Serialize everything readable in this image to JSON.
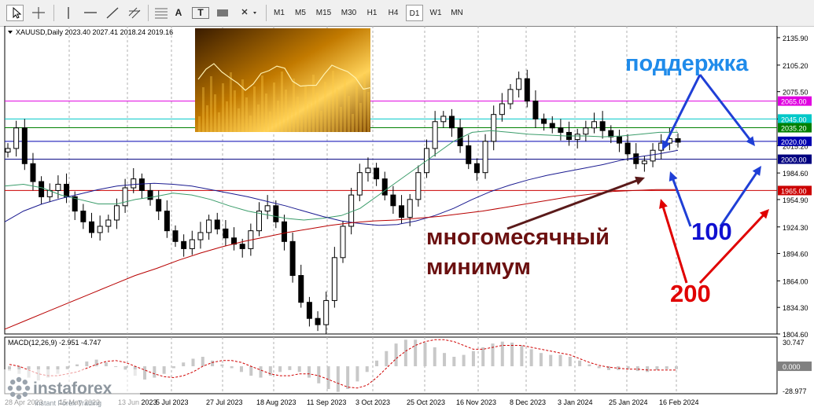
{
  "toolbar": {
    "tools": [
      "cursor-icon",
      "crosshair-icon",
      "vertical-line-icon",
      "horizontal-line-icon",
      "trendline-icon",
      "channel-icon",
      "text-icon",
      "label-icon",
      "shape-icon",
      "arrow-icon"
    ],
    "text_tool": "A",
    "label_tool": "T",
    "timeframes": [
      "M1",
      "M5",
      "M15",
      "M30",
      "H1",
      "H4",
      "D1",
      "W1",
      "MN"
    ],
    "active_timeframe": "D1"
  },
  "chart_data": {
    "type": "candlestick",
    "symbol": "XAUUSD,Daily",
    "ohlc": "2023.40 2027.41 2018.24 2019.16",
    "y_ticks": [
      "2135.90",
      "2105.20",
      "2075.50",
      "2045.00",
      "2015.20",
      "1984.60",
      "1954.90",
      "1924.30",
      "1894.60",
      "1864.00",
      "1834.30",
      "1804.60"
    ],
    "ylim": [
      1804.6,
      2149
    ],
    "x_labels": [
      "28 Apr 2023",
      "15 May 2023",
      "13 Jun 2023",
      "5 Jul 2023",
      "27 Jul 2023",
      "18 Aug 2023",
      "11 Sep 2023",
      "3 Oct 2023",
      "25 Oct 2023",
      "16 Nov 2023",
      "8 Dec 2023",
      "3 Jan 2024",
      "25 Jan 2024",
      "16 Feb 2024"
    ],
    "price_levels": [
      {
        "value": 2065.0,
        "label": "2065.00",
        "color": "#e000e0"
      },
      {
        "value": 2045.0,
        "label": "2045.00",
        "color": "#00c8c8"
      },
      {
        "value": 2035.2,
        "label": "2035.20",
        "color": "#008000"
      },
      {
        "value": 2020.0,
        "label": "2020.00",
        "color": "#0000b0"
      },
      {
        "value": 2000.0,
        "label": "2000.00",
        "color": "#000080"
      },
      {
        "value": 1965.0,
        "label": "1965.00",
        "color": "#cc0000"
      }
    ],
    "series": [
      {
        "name": "",
        "close": [
          2012,
          2035,
          1995,
          1975,
          1958,
          1965,
          1972,
          1958,
          1942,
          1930,
          1918,
          1925,
          1932,
          1948,
          1968,
          1978,
          1965,
          1955,
          1942,
          1920,
          1908,
          1900,
          1910,
          1918,
          1932,
          1922,
          1912,
          1905,
          1900,
          1920,
          1942,
          1948,
          1930,
          1908,
          1870,
          1840,
          1822,
          1815,
          1842,
          1890,
          1925,
          1960,
          1985,
          1990,
          1978,
          1960,
          1948,
          1935,
          1955,
          1985,
          2012,
          2042,
          2048,
          2035,
          2015,
          1995,
          1985,
          2020,
          2050,
          2062,
          2078,
          2090,
          2065,
          2045,
          2040,
          2035,
          2030,
          2022,
          2028,
          2035,
          2042,
          2032,
          2025,
          2018,
          2006,
          1995,
          1998,
          2010,
          2018,
          2023,
          2019
        ]
      },
      {
        "name": "",
        "values": [
          1970,
          1972,
          1968,
          1960,
          1955,
          1950,
          1950,
          1955,
          1958,
          1962,
          1960,
          1955,
          1948,
          1942,
          1938,
          1934,
          1932,
          1934,
          1937,
          1945,
          1960,
          1975,
          1990,
          2005,
          2020,
          2030,
          2032,
          2030,
          2028,
          2027,
          2026,
          2026,
          2025,
          2026,
          2028,
          2030,
          2030
        ]
      },
      {
        "name": "",
        "values": [
          1930,
          1942,
          1950,
          1956,
          1961,
          1966,
          1970,
          1972,
          1973,
          1972,
          1970,
          1966,
          1962,
          1958,
          1953,
          1948,
          1942,
          1936,
          1931,
          1928,
          1926,
          1927,
          1931,
          1937,
          1945,
          1955,
          1964,
          1971,
          1977,
          1982,
          1986,
          1990,
          1994,
          1999,
          2003,
          2006,
          2010
        ]
      },
      {
        "name": "",
        "values": [
          1810,
          1820,
          1830,
          1840,
          1850,
          1860,
          1870,
          1878,
          1887,
          1895,
          1902,
          1908,
          1913,
          1918,
          1922,
          1926,
          1929,
          1931,
          1932,
          1934,
          1936,
          1939,
          1942,
          1946,
          1950,
          1954,
          1958,
          1961,
          1964,
          1965,
          1966,
          1966
        ]
      }
    ],
    "annotations": [
      "поддержка",
      "многомесячный",
      "минимум",
      "100",
      "200"
    ],
    "indicator": {
      "name": "MACD(12,26,9)",
      "readout": "-2.951 -4.747",
      "y_ticks": [
        "30.747",
        "0.000",
        "-28.977"
      ],
      "ylim": [
        -28.977,
        30.747
      ],
      "histogram": [
        -5,
        -8,
        -12,
        -15,
        -12,
        -8,
        -3,
        2,
        5,
        7,
        4,
        0,
        -4,
        -10,
        -14,
        -12,
        -8,
        -2,
        4,
        8,
        10,
        6,
        2,
        -2,
        -6,
        -10,
        -12,
        -10,
        -6,
        -4,
        -6,
        -12,
        -18,
        -24,
        -27,
        -24,
        -16,
        -6,
        6,
        16,
        24,
        28,
        28,
        25,
        20,
        14,
        10,
        12,
        16,
        20,
        24,
        26,
        25,
        22,
        18,
        14,
        12,
        12,
        10,
        6,
        2,
        -2,
        -4,
        -4,
        -3,
        -5,
        -6,
        -4,
        -3,
        -3
      ],
      "signal": [
        2,
        0,
        -4,
        -8,
        -10,
        -10,
        -8,
        -6,
        -2,
        2,
        5,
        6,
        4,
        0,
        -4,
        -8,
        -11,
        -12,
        -10,
        -6,
        0,
        4,
        6,
        6,
        4,
        0,
        -4,
        -8,
        -10,
        -10,
        -8,
        -8,
        -10,
        -14,
        -18,
        -22,
        -23,
        -20,
        -12,
        -2,
        8,
        16,
        22,
        26,
        28,
        28,
        26,
        22,
        18,
        18,
        20,
        22,
        22,
        22,
        20,
        18,
        16,
        14,
        12,
        8,
        4,
        1,
        -1,
        -2,
        -3,
        -3,
        -4,
        -4,
        -4,
        -4
      ]
    }
  },
  "watermark": {
    "brand": "instaforex",
    "tagline": "Instant Forex Trading"
  }
}
